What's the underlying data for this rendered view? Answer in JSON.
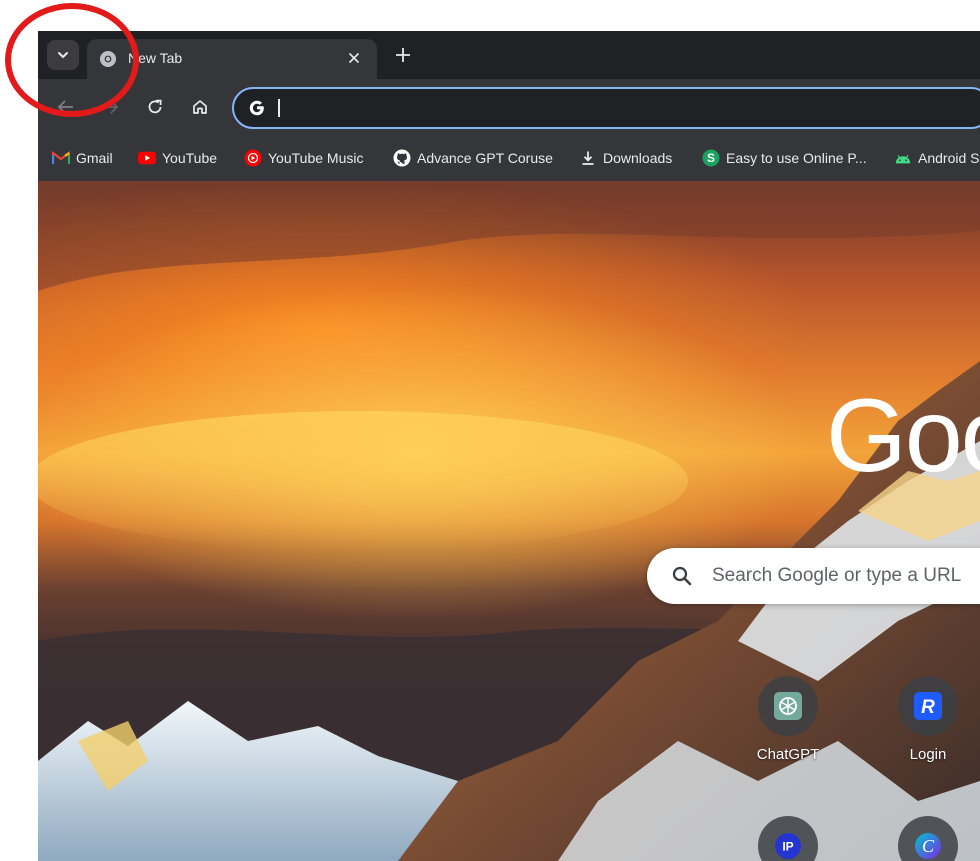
{
  "tab": {
    "title": "New Tab"
  },
  "toolbar": {
    "omnibox_value": ""
  },
  "bookmarks": [
    {
      "label": "Gmail",
      "icon": "gmail-icon"
    },
    {
      "label": "YouTube",
      "icon": "youtube-icon"
    },
    {
      "label": "YouTube Music",
      "icon": "youtube-music-icon"
    },
    {
      "label": "Advance GPT Coruse",
      "icon": "github-icon"
    },
    {
      "label": "Downloads",
      "icon": "download-icon"
    },
    {
      "label": "Easy to use Online P...",
      "icon": "s-logo-icon"
    },
    {
      "label": "Android S",
      "icon": "android-icon"
    }
  ],
  "ntp": {
    "logo_text": "Goo",
    "search_placeholder": "Search Google or type a URL",
    "shortcuts": [
      {
        "label": "ChatGPT",
        "icon": "chatgpt-icon"
      },
      {
        "label": "Login",
        "icon": "r-logo-icon"
      },
      {
        "label": "",
        "icon": "ip-icon",
        "badge": "IP"
      },
      {
        "label": "",
        "icon": "canva-icon",
        "badge": "C"
      }
    ]
  },
  "colors": {
    "accent": "#8ab4f8",
    "annotation": "#e31a1a",
    "frame": "#35363a",
    "titlebar": "#202124"
  }
}
